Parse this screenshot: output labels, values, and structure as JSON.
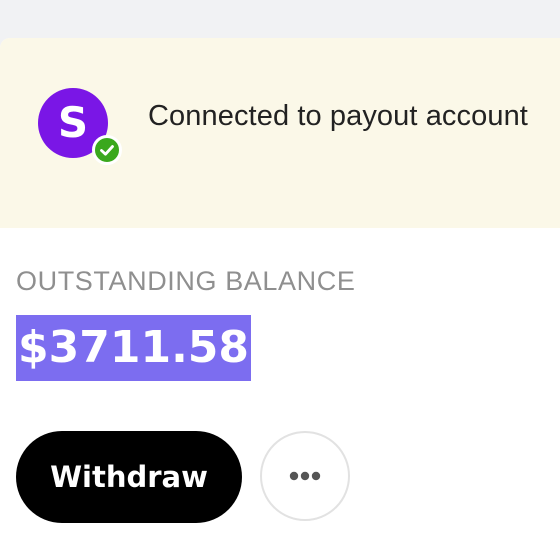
{
  "banner": {
    "avatar_letter": "S",
    "avatar_color": "#7a16e6",
    "badge_icon": "check-icon",
    "badge_color": "#3aa81d",
    "text": "Connected to payout account"
  },
  "balance": {
    "label": "OUTSTANDING BALANCE",
    "amount": "$3711.58",
    "highlight_color": "#7c6df0"
  },
  "actions": {
    "withdraw_label": "Withdraw",
    "more_icon": "more-horizontal-icon"
  }
}
